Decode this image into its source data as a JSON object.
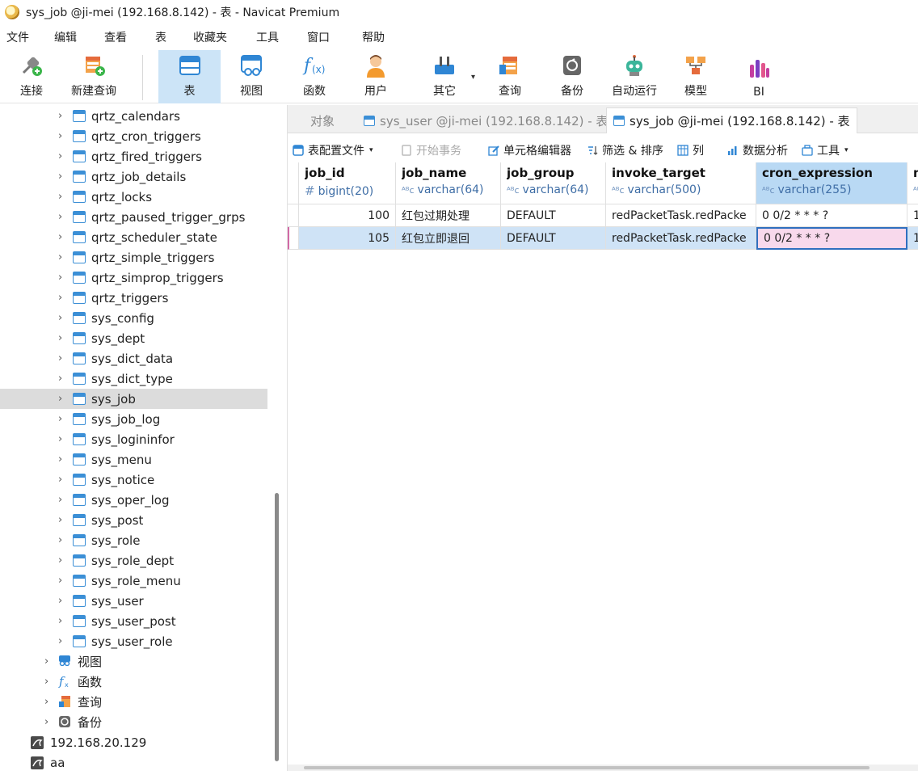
{
  "window": {
    "title": "sys_job @ji-mei (192.168.8.142) - 表 - Navicat Premium"
  },
  "menu": [
    "文件",
    "编辑",
    "查看",
    "表",
    "收藏夹",
    "工具",
    "窗口",
    "帮助"
  ],
  "toolbar": {
    "connect": "连接",
    "new_query": "新建查询",
    "table": "表",
    "view": "视图",
    "function": "函数",
    "user": "用户",
    "other": "其它",
    "query": "查询",
    "backup": "备份",
    "automation": "自动运行",
    "model": "模型",
    "bi": "BI"
  },
  "sidebar": {
    "tables": [
      "qrtz_calendars",
      "qrtz_cron_triggers",
      "qrtz_fired_triggers",
      "qrtz_job_details",
      "qrtz_locks",
      "qrtz_paused_trigger_grps",
      "qrtz_scheduler_state",
      "qrtz_simple_triggers",
      "qrtz_simprop_triggers",
      "qrtz_triggers",
      "sys_config",
      "sys_dept",
      "sys_dict_data",
      "sys_dict_type",
      "sys_job",
      "sys_job_log",
      "sys_logininfor",
      "sys_menu",
      "sys_notice",
      "sys_oper_log",
      "sys_post",
      "sys_role",
      "sys_role_dept",
      "sys_role_menu",
      "sys_user",
      "sys_user_post",
      "sys_user_role"
    ],
    "selected": "sys_job",
    "groups": [
      "视图",
      "函数",
      "查询",
      "备份"
    ],
    "connections": [
      "192.168.20.129",
      "aa"
    ]
  },
  "tabs": {
    "objects": "对象",
    "tab1": "sys_user @ji-mei (192.168.8.142) - 表",
    "tab2": "sys_job @ji-mei (192.168.8.142) - 表"
  },
  "obj_toolbar": {
    "table_profile": "表配置文件",
    "begin_tx": "开始事务",
    "cell_editor": "单元格编辑器",
    "filter_sort": "筛选 & 排序",
    "columns": "列",
    "data_analysis": "数据分析",
    "tools": "工具"
  },
  "grid": {
    "columns": [
      {
        "name": "job_id",
        "type": "bigint(20)",
        "kind": "#"
      },
      {
        "name": "job_name",
        "type": "varchar(64)",
        "kind": "ABC"
      },
      {
        "name": "job_group",
        "type": "varchar(64)",
        "kind": "ABC"
      },
      {
        "name": "invoke_target",
        "type": "varchar(500)",
        "kind": "ABC"
      },
      {
        "name": "cron_expression",
        "type": "varchar(255)",
        "kind": "ABC"
      },
      {
        "name": "m",
        "type": "",
        "kind": "ABC"
      }
    ],
    "rows": [
      [
        "100",
        "红包过期处理",
        "DEFAULT",
        "redPacketTask.redPacke",
        "0 0/2 * * * ?",
        "1"
      ],
      [
        "105",
        "红包立即退回",
        "DEFAULT",
        "redPacketTask.redPacke",
        "0 0/2 * * * ?",
        "1"
      ]
    ]
  }
}
